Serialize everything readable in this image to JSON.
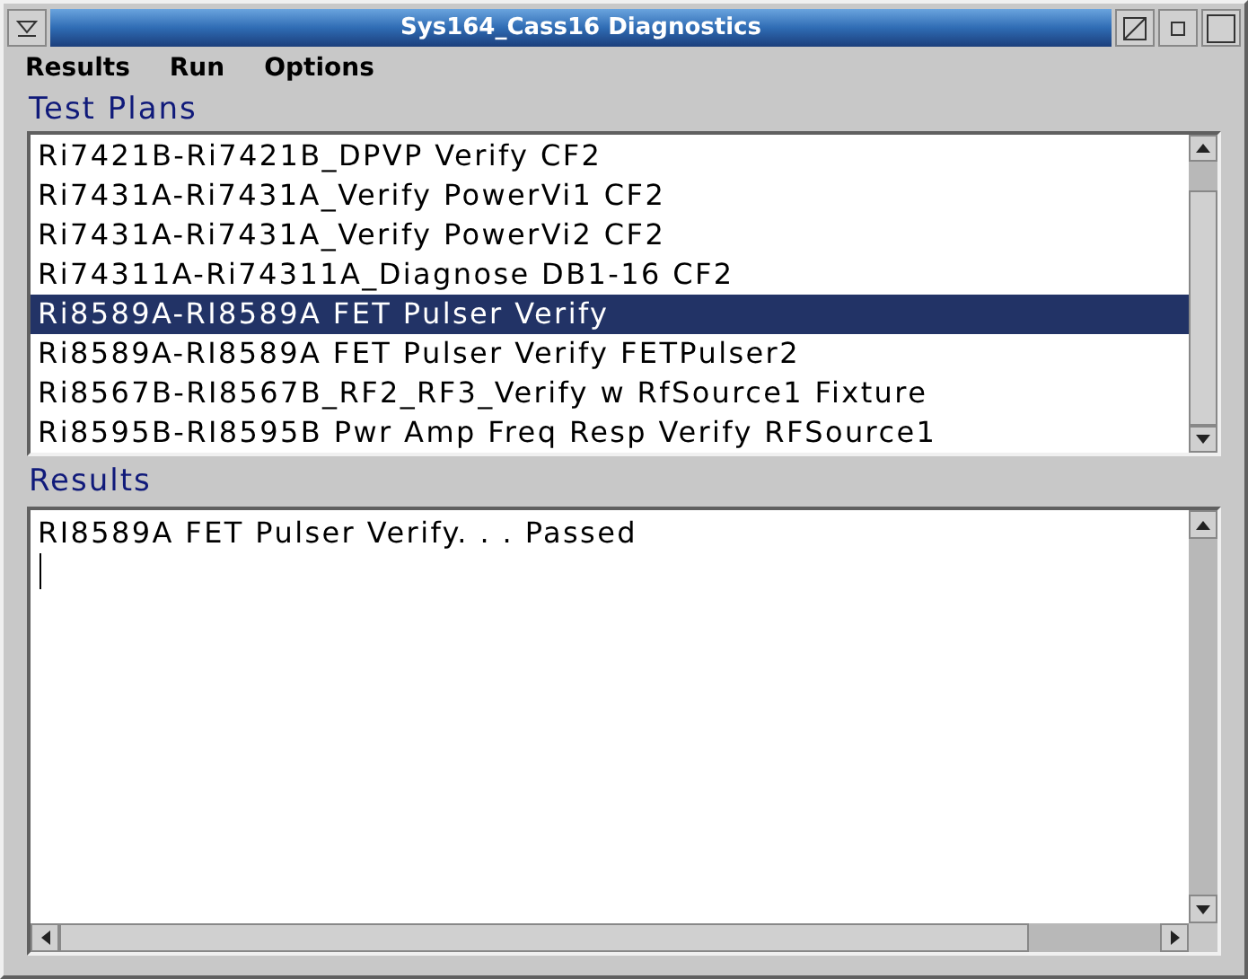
{
  "window": {
    "title": "Sys164_Cass16 Diagnostics"
  },
  "menu": [
    "Results",
    "Run",
    "Options"
  ],
  "test_plans": {
    "label": "Test Plans",
    "items": [
      {
        "text": "Ri7421B-Ri7421B_DPVP Verify CF2",
        "selected": false
      },
      {
        "text": "Ri7431A-Ri7431A_Verify PowerVi1 CF2",
        "selected": false
      },
      {
        "text": "Ri7431A-Ri7431A_Verify PowerVi2 CF2",
        "selected": false
      },
      {
        "text": "Ri74311A-Ri74311A_Diagnose DB1-16 CF2",
        "selected": false
      },
      {
        "text": "Ri8589A-RI8589A FET Pulser Verify",
        "selected": true
      },
      {
        "text": "Ri8589A-RI8589A FET Pulser Verify FETPulser2",
        "selected": false
      },
      {
        "text": "Ri8567B-RI8567B_RF2_RF3_Verify w RfSource1 Fixture",
        "selected": false
      },
      {
        "text": "Ri8595B-RI8595B Pwr Amp Freq Resp Verify RFSource1",
        "selected": false
      }
    ]
  },
  "results": {
    "label": "Results",
    "lines": [
      "RI8589A FET Pulser Verify. . . Passed"
    ]
  }
}
